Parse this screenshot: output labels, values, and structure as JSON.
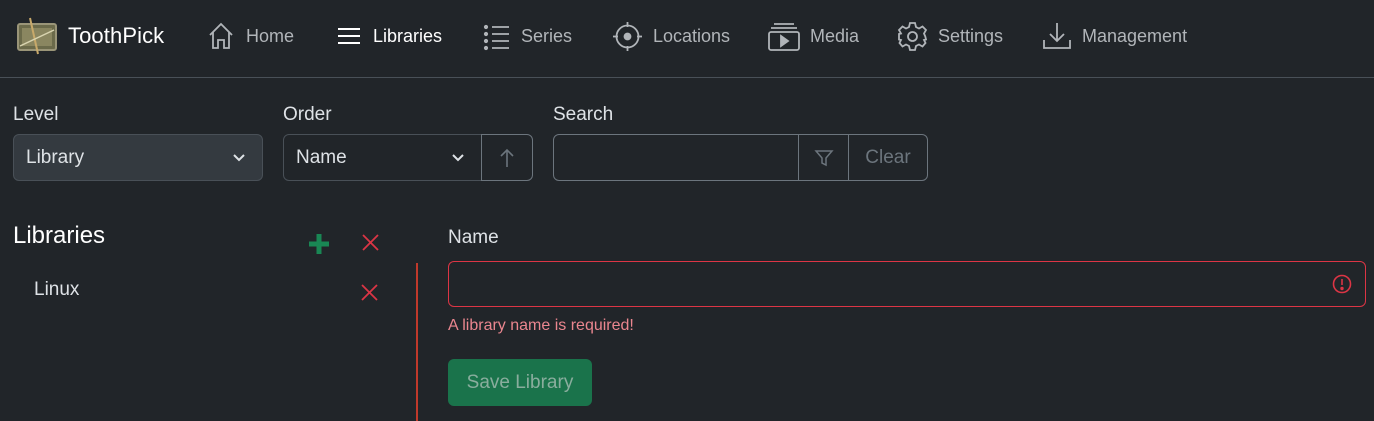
{
  "brand": {
    "name": "ToothPick"
  },
  "nav": {
    "home": "Home",
    "libraries": "Libraries",
    "series": "Series",
    "locations": "Locations",
    "media": "Media",
    "settings": "Settings",
    "management": "Management",
    "active": "Libraries"
  },
  "filters": {
    "level_label": "Level",
    "level_value": "Library",
    "order_label": "Order",
    "order_value": "Name",
    "order_direction_icon": "arrow-up-icon",
    "search_label": "Search",
    "search_value": "",
    "search_placeholder": "",
    "filter_icon": "funnel-icon",
    "clear_label": "Clear"
  },
  "libraries": {
    "title": "Libraries",
    "items": [
      {
        "label": "Linux"
      }
    ]
  },
  "form": {
    "name_label": "Name",
    "name_value": "",
    "error": "A library name is required!",
    "save_label": "Save Library"
  },
  "colors": {
    "background": "#212529",
    "accent_green": "#198754",
    "danger": "#dc3545",
    "error_text": "#ea868f",
    "muted": "#6c757d"
  }
}
